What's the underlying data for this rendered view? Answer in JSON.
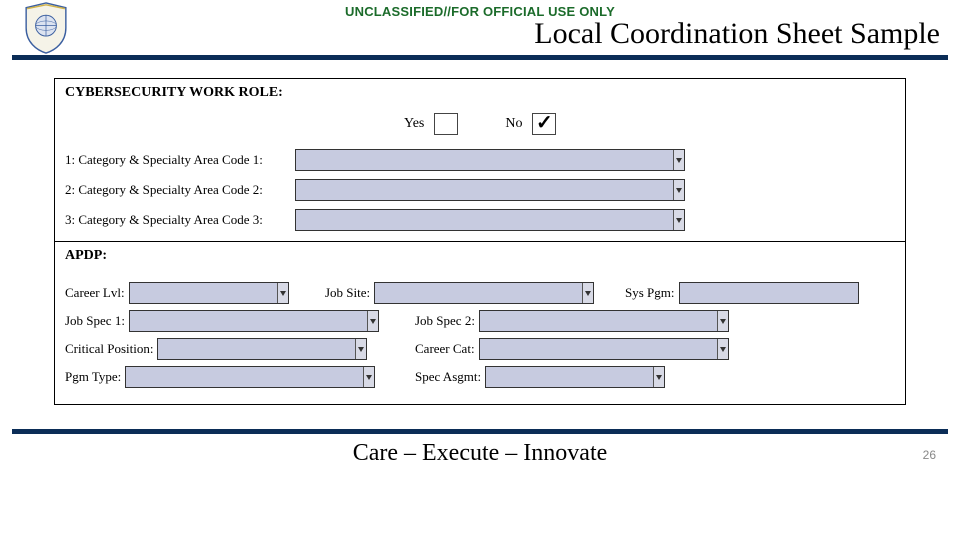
{
  "header": {
    "classification": "UNCLASSIFIED//FOR OFFICIAL USE ONLY",
    "title": "Local Coordination Sheet Sample"
  },
  "form": {
    "cyber": {
      "label": "CYBERSECURITY WORK ROLE:",
      "yes": "Yes",
      "no": "No",
      "rows": [
        "1: Category & Specialty Area Code 1:",
        "2: Category & Specialty Area Code 2:",
        "3: Category & Specialty Area Code 3:"
      ]
    },
    "apdp": {
      "label": "APDP:",
      "career_lvl": "Career Lvl:",
      "job_site": "Job Site:",
      "sys_pgm": "Sys Pgm:",
      "job_spec1": "Job Spec 1:",
      "job_spec2": "Job Spec 2:",
      "critical_position": "Critical Position:",
      "career_cat": "Career Cat:",
      "pgm_type": "Pgm Type:",
      "spec_asgmt": "Spec Asgmt:"
    }
  },
  "footer": {
    "tagline": "Care – Execute – Innovate",
    "page": "26"
  }
}
